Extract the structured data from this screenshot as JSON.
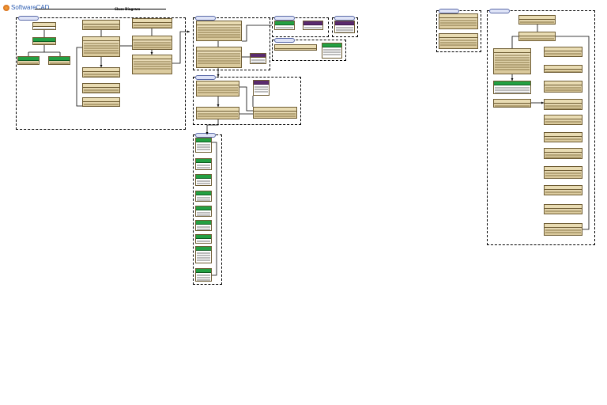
{
  "header": {
    "logo_text": "SoftwareCAD",
    "diagram_title": "Class Diagram"
  },
  "colors": {
    "class_fill": "#e3d5ab",
    "class_border": "#6d5b32",
    "stereotype_green": "#23a043",
    "stereotype_purple": "#5a2a6e",
    "package_tab": "#dfe4f7"
  },
  "packages": [
    {
      "id": "p1",
      "label": ""
    },
    {
      "id": "p2",
      "label": ""
    },
    {
      "id": "p3",
      "label": ""
    },
    {
      "id": "p4",
      "label": ""
    },
    {
      "id": "p5",
      "label": ""
    },
    {
      "id": "p6",
      "label": ""
    },
    {
      "id": "p7",
      "label": ""
    },
    {
      "id": "p8",
      "label": ""
    },
    {
      "id": "p9",
      "label": ""
    },
    {
      "id": "p10",
      "label": ""
    }
  ],
  "classes": [
    {
      "id": "c1",
      "title": ""
    },
    {
      "id": "c2",
      "title": ""
    },
    {
      "id": "c3",
      "title": ""
    },
    {
      "id": "c4",
      "title": ""
    },
    {
      "id": "c5",
      "title": ""
    },
    {
      "id": "c6",
      "title": ""
    },
    {
      "id": "c7",
      "title": ""
    },
    {
      "id": "c8",
      "title": ""
    },
    {
      "id": "c9",
      "title": ""
    },
    {
      "id": "c10",
      "title": ""
    },
    {
      "id": "c11",
      "title": ""
    },
    {
      "id": "c12",
      "title": ""
    },
    {
      "id": "c13",
      "title": ""
    },
    {
      "id": "c14",
      "title": ""
    },
    {
      "id": "c15",
      "title": ""
    },
    {
      "id": "c16",
      "title": ""
    },
    {
      "id": "c17",
      "title": ""
    },
    {
      "id": "c18",
      "title": ""
    },
    {
      "id": "c19",
      "title": ""
    },
    {
      "id": "c20",
      "title": ""
    },
    {
      "id": "c21",
      "title": ""
    },
    {
      "id": "c22",
      "title": ""
    },
    {
      "id": "c23",
      "title": ""
    },
    {
      "id": "c24",
      "title": ""
    },
    {
      "id": "c25",
      "title": ""
    },
    {
      "id": "c26",
      "title": ""
    },
    {
      "id": "c27",
      "title": ""
    },
    {
      "id": "c28",
      "title": ""
    },
    {
      "id": "c29",
      "title": ""
    },
    {
      "id": "c30",
      "title": ""
    },
    {
      "id": "c31",
      "title": ""
    },
    {
      "id": "c32",
      "title": ""
    },
    {
      "id": "c33",
      "title": ""
    },
    {
      "id": "c34",
      "title": ""
    },
    {
      "id": "c35",
      "title": ""
    },
    {
      "id": "c36",
      "title": ""
    },
    {
      "id": "c37",
      "title": ""
    },
    {
      "id": "c38",
      "title": ""
    },
    {
      "id": "c39",
      "title": ""
    },
    {
      "id": "c40",
      "title": ""
    },
    {
      "id": "c41",
      "title": ""
    },
    {
      "id": "c42",
      "title": ""
    },
    {
      "id": "c43",
      "title": ""
    },
    {
      "id": "c44",
      "title": ""
    },
    {
      "id": "c45",
      "title": ""
    },
    {
      "id": "c46",
      "title": ""
    },
    {
      "id": "c47",
      "title": ""
    },
    {
      "id": "c48",
      "title": ""
    },
    {
      "id": "c49",
      "title": ""
    },
    {
      "id": "c50",
      "title": ""
    },
    {
      "id": "c51",
      "title": ""
    },
    {
      "id": "c52",
      "title": ""
    },
    {
      "id": "c53",
      "title": ""
    },
    {
      "id": "c54",
      "title": ""
    },
    {
      "id": "c55",
      "title": ""
    },
    {
      "id": "c56",
      "title": ""
    },
    {
      "id": "c57",
      "title": ""
    },
    {
      "id": "c58",
      "title": ""
    },
    {
      "id": "c59",
      "title": ""
    }
  ]
}
